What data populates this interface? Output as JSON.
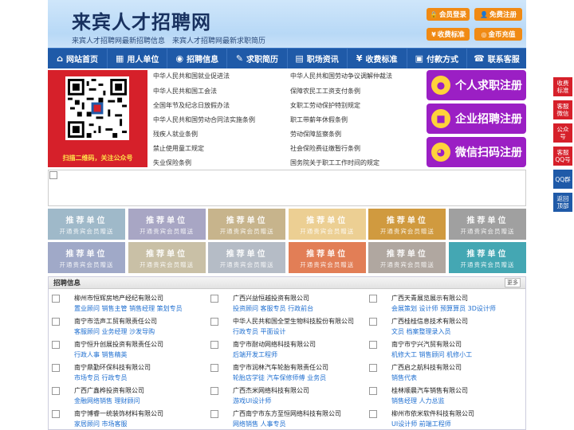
{
  "header": {
    "title": "来宾人才招聘网",
    "subtitle": "来宾人才招聘网最新招聘信息　来宾人才招聘网最新求职简历",
    "buttons": [
      {
        "label": "会员登录",
        "icon": "lock-icon"
      },
      {
        "label": "免费注册",
        "icon": "user-icon"
      },
      {
        "label": "收费标准",
        "icon": "yen-icon"
      },
      {
        "label": "金币充值",
        "icon": "coin-icon"
      }
    ]
  },
  "nav": [
    {
      "label": "网站首页",
      "icon": "home-icon"
    },
    {
      "label": "用人单位",
      "icon": "building-icon"
    },
    {
      "label": "招聘信息",
      "icon": "megaphone-icon"
    },
    {
      "label": "求职简历",
      "icon": "pencil-icon"
    },
    {
      "label": "职场资讯",
      "icon": "news-icon"
    },
    {
      "label": "收费标准",
      "icon": "yen-icon"
    },
    {
      "label": "付款方式",
      "icon": "wallet-icon"
    },
    {
      "label": "联系客服",
      "icon": "phone-icon"
    }
  ],
  "qr": {
    "caption": "扫描二维码，关注公众号"
  },
  "laws": [
    "中华人民共和国就业促进法",
    "中华人民共和国劳动争议调解仲裁法",
    "中华人民共和国工会法",
    "保障农民工工资支付条例",
    "全国年节及纪念日放假办法",
    "女职工劳动保护特别规定",
    "中华人民共和国劳动合同法实施条例",
    "职工带薪年休假条例",
    "残疾人就业条例",
    "劳动保障监察条例",
    "禁止使用童工规定",
    "社会保险费征缴暂行条例",
    "失业保险条例",
    "国务院关于职工工作时间的规定"
  ],
  "register": [
    {
      "label": "个人求职注册",
      "icon": "person-icon"
    },
    {
      "label": "企业招聘注册",
      "icon": "company-icon"
    },
    {
      "label": "微信扫码注册",
      "icon": "wechat-icon"
    }
  ],
  "tiles": {
    "title": "推荐单位",
    "subtitle": "开通贵宾会员赠送",
    "colors": [
      "#9fb9c9",
      "#a8a6c4",
      "#c7b48c",
      "#eccf93",
      "#d09a3f",
      "#a0a0a0",
      "#a0a9c8",
      "#c9c0a6",
      "#b5bcc6",
      "#e27e56",
      "#b0a7a0",
      "#44a7b3"
    ]
  },
  "jobs": {
    "title": "招聘信息",
    "more": "更多",
    "items": [
      {
        "company": "柳州市恒辉房地产经纪有限公司",
        "positions": "置业顾问 销售主管 销售经理 策划专员"
      },
      {
        "company": "广西兴益恒越投资有限公司",
        "positions": "投资顾问 客服专员 行政前台"
      },
      {
        "company": "广西天青展览展示有限公司",
        "positions": "会展策划 设计师 预算算员 3D设计师"
      },
      {
        "company": "南宁市浩声工贸有限责任公司",
        "positions": "客服顾问 业务经理 沙发导购"
      },
      {
        "company": "中华人民共和国全堂生物科技股份有限公司",
        "positions": "行政专员 平面设计"
      },
      {
        "company": "广西桂桂信息技术有限公司",
        "positions": "文员 档案整理录入员"
      },
      {
        "company": "南宁恒升创展投资有限责任公司",
        "positions": "行政人事 销售精英"
      },
      {
        "company": "南宁市耐动网络科技有限公司",
        "positions": "后端开发工程师"
      },
      {
        "company": "南宁市宁兴汽贸有限公司",
        "positions": "机修大工 销售顾问 机修小工"
      },
      {
        "company": "南宁鼎勤环保科技有限公司",
        "positions": "市场专员 行政专员"
      },
      {
        "company": "南宁市润林汽车轮胎有限责任公司",
        "positions": "轮胎店学徒 汽车保修师傅 业务员"
      },
      {
        "company": "广西启之航科技有限公司",
        "positions": "销售代表"
      },
      {
        "company": "广西广鑫桦投资有限公司",
        "positions": "金融网络销售 理财顾问"
      },
      {
        "company": "广西杰米网络科技有限公司",
        "positions": "游戏UI设计师"
      },
      {
        "company": "桂林顺晨汽车销售有限公司",
        "positions": "销售经理 人力总监"
      },
      {
        "company": "南宁博睿一统装饰材料有限公司",
        "positions": "家居顾问 市场客服"
      },
      {
        "company": "广西南宁市东方至恒网络科技有限公司",
        "positions": "网络销售 人事专员"
      },
      {
        "company": "柳州市依米软件科技有限公司",
        "positions": "UI设计师 前端工程师"
      }
    ]
  },
  "float": [
    "收费标准",
    "客服微信",
    "公众号",
    "客服QQ号",
    "QQ群",
    "返回顶部"
  ]
}
